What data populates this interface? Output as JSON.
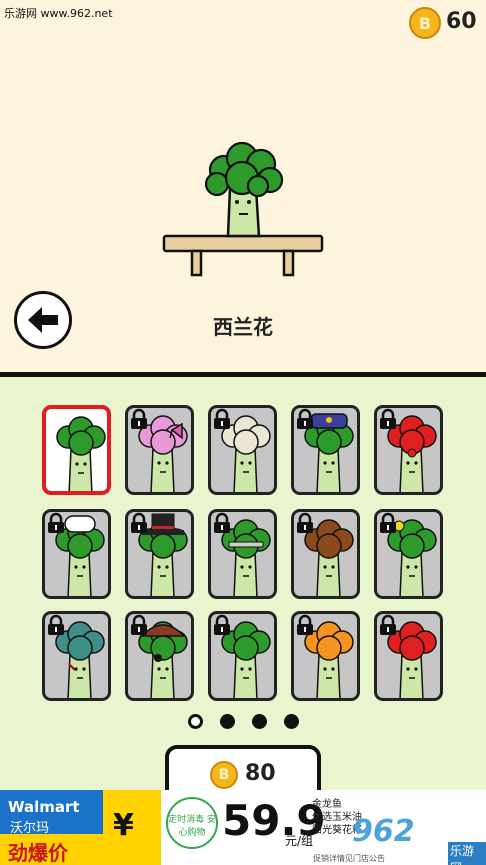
{
  "watermark": "乐游网 www.962.net",
  "header": {
    "coins": "60",
    "coin_symbol": "B"
  },
  "character": {
    "name": "西兰花"
  },
  "grid": {
    "cells": [
      {
        "locked": false,
        "selected": true,
        "head": "#2f9a2c",
        "hat": "none"
      },
      {
        "locked": true,
        "head": "#e79ad7",
        "hat": "bow"
      },
      {
        "locked": true,
        "head": "#ece6d4",
        "hat": "none"
      },
      {
        "locked": true,
        "head": "#2f9a2c",
        "hat": "police"
      },
      {
        "locked": true,
        "head": "#e02020",
        "hat": "clown"
      },
      {
        "locked": true,
        "head": "#2f9a2c",
        "hat": "chef"
      },
      {
        "locked": true,
        "head": "#2f9a2c",
        "hat": "tophat"
      },
      {
        "locked": true,
        "head": "#2f9a2c",
        "hat": "robot"
      },
      {
        "locked": true,
        "head": "#8a4a1c",
        "hat": "none"
      },
      {
        "locked": true,
        "head": "#2f9a2c",
        "hat": "flower"
      },
      {
        "locked": true,
        "head": "#3f8f88",
        "hat": "zombie"
      },
      {
        "locked": true,
        "head": "#2f9a2c",
        "hat": "pirate"
      },
      {
        "locked": true,
        "head": "#2f9a2c",
        "hat": "none"
      },
      {
        "locked": true,
        "head": "#f5941f",
        "hat": "none"
      },
      {
        "locked": true,
        "head": "#e02020",
        "hat": "none"
      }
    ]
  },
  "pagination": {
    "pages": 4,
    "current": 1
  },
  "purchase": {
    "price": "80",
    "coin_symbol": "B"
  },
  "ad": {
    "brand": "Walmart",
    "brand_cn": "沃尔玛",
    "tagline": "劲爆价",
    "yen": "¥",
    "badge": "定时消毒 安心购物",
    "price": "59.9",
    "unit": "元/组",
    "line1": "金龙鱼",
    "line2": "优选玉米油",
    "line3": "阳光葵花籽",
    "logo": "962",
    "logo2": "乐游网",
    "footer": "促销详情见门店公告"
  }
}
